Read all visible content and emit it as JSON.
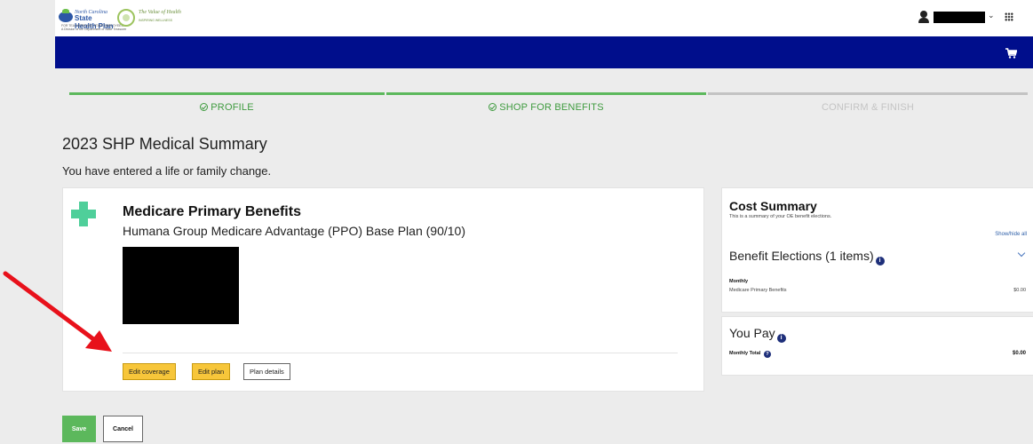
{
  "header": {
    "logo_shp": {
      "tagline": "North Carolina",
      "name": "State Health Plan",
      "sub1": "FOR TEACHERS AND STATE EMPLOYEES",
      "sub2": "A Division of the Department of State Treasurer"
    },
    "logo_partner": {
      "script": "The Value of Health",
      "sub": "INSPIRING WELLNESS"
    },
    "user": {
      "name_redacted": true,
      "caret": "⌄"
    },
    "icons": [
      "user-icon",
      "apps-grid-icon",
      "cart-icon"
    ]
  },
  "progress": {
    "steps": [
      {
        "label": "PROFILE",
        "status": "complete"
      },
      {
        "label": "SHOP FOR BENEFITS",
        "status": "complete"
      },
      {
        "label": "CONFIRM & FINISH",
        "status": "pending"
      }
    ]
  },
  "page": {
    "title": "2023 SHP Medical Summary",
    "subtitle": "You have entered a life or family change."
  },
  "plan": {
    "title": "Medicare Primary Benefits",
    "name": "Humana Group Medicare Advantage (PPO) Base Plan (90/10)",
    "buttons": {
      "edit_coverage": "Edit coverage",
      "edit_plan": "Edit plan",
      "plan_details": "Plan details"
    }
  },
  "cost_summary": {
    "title": "Cost Summary",
    "subtitle": "This is a summary of your OE benefit elections.",
    "show_hide": "Show/hide all",
    "elections_title": "Benefit Elections (1 items)",
    "frequency": "Monthly",
    "rows": [
      {
        "label": "Medicare Primary Benefits",
        "value": "$0.00"
      }
    ]
  },
  "you_pay": {
    "title": "You Pay",
    "total_label": "Monthly Total",
    "total_value": "$0.00"
  },
  "actions": {
    "save": "Save",
    "cancel": "Cancel"
  },
  "colors": {
    "nav_blue": "#000e8c",
    "progress_green": "#5cb85c",
    "button_yellow": "#f7c63a",
    "annotation_red": "#e8111b"
  }
}
